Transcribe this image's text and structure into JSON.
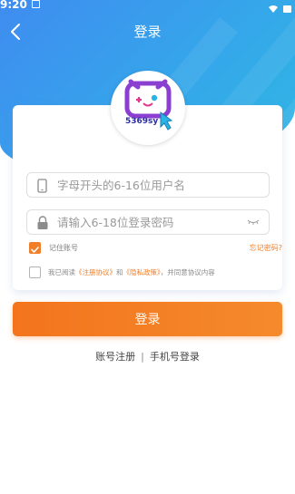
{
  "status_bar": {
    "time": "9:20"
  },
  "header": {
    "title": "登录"
  },
  "logo": {
    "text": "5369sy"
  },
  "form": {
    "username_placeholder": "字母开头的6-16位用户名",
    "password_placeholder": "请输入6-18位登录密码",
    "remember_label": "记住账号",
    "remember_checked": true,
    "forgot_label": "忘记密码?",
    "agree_checked": false,
    "agree": {
      "prefix": "我已阅读",
      "terms_link": "《注册协议》",
      "and": "和",
      "privacy_link": "《隐私政策》",
      "suffix": "，并同意协议内容"
    }
  },
  "actions": {
    "login_label": "登录",
    "register_label": "账号注册",
    "separator": "|",
    "phone_login_label": "手机号登录"
  },
  "colors": {
    "header_gradient_start": "#3f8cf0",
    "header_gradient_end": "#2fb8e4",
    "accent_orange": "#f3741c",
    "logo_purple": "#8b3fd1"
  }
}
